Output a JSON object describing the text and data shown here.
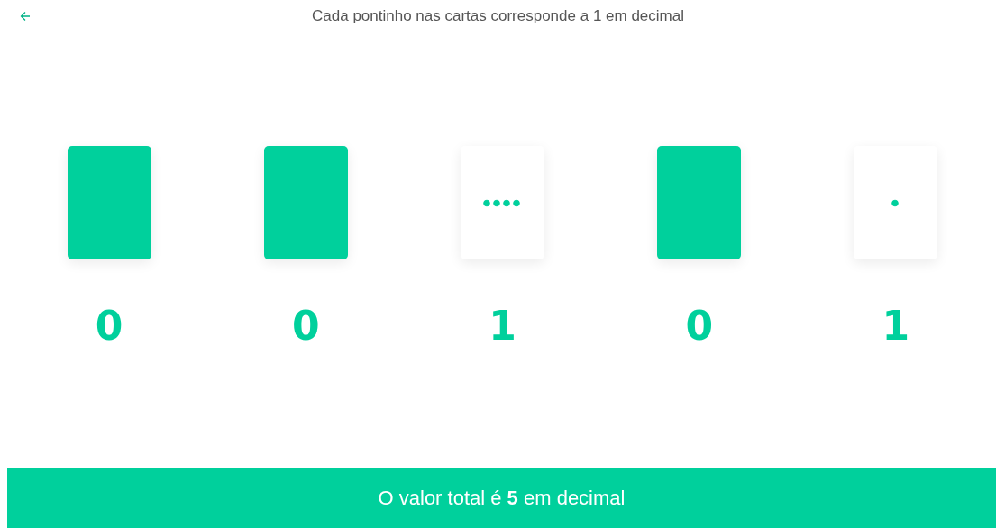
{
  "header": {
    "title": "Cada pontinho nas cartas corresponde a 1 em decimal"
  },
  "cards": [
    {
      "face_up": false,
      "digit": "0"
    },
    {
      "face_up": false,
      "digit": "0"
    },
    {
      "face_up": true,
      "dots": [
        {
          "filled": true
        },
        {
          "filled": true
        },
        {
          "filled": true
        },
        {
          "filled": true
        }
      ],
      "digit": "1"
    },
    {
      "face_up": false,
      "digit": "0"
    },
    {
      "face_up": true,
      "dots": [
        {
          "filled": true
        }
      ],
      "digit": "1"
    }
  ],
  "footer": {
    "text": "O valor total é **5** em decimal"
  }
}
